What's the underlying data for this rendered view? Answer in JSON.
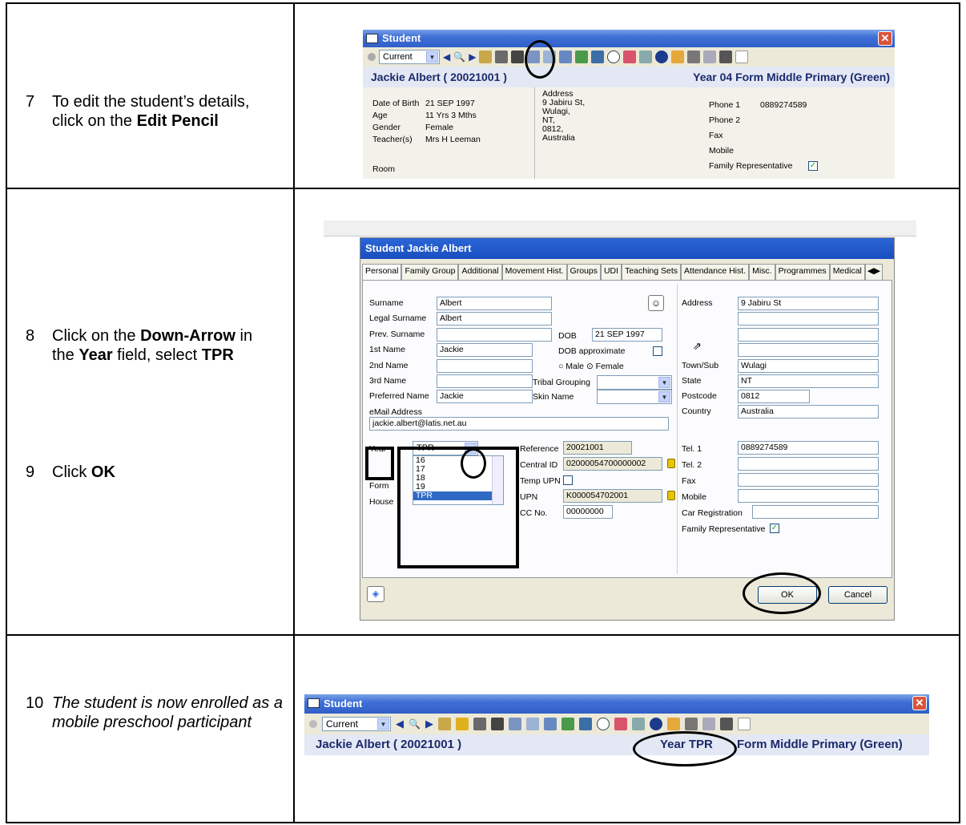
{
  "steps": [
    {
      "num": "7",
      "text_parts": [
        "To edit the student’s details, click on the ",
        "Edit Pencil"
      ]
    },
    {
      "num": "8",
      "text_parts": [
        "Click on the ",
        "Down-Arrow",
        " in the ",
        "Year",
        " field, select ",
        "TPR"
      ]
    },
    {
      "num": "9",
      "text_parts": [
        "Click ",
        "OK"
      ]
    },
    {
      "num": "10",
      "text": "The student is now enrolled as a mobile preschool participant"
    }
  ],
  "window1": {
    "title": "Student",
    "filter_value": "Current",
    "student_header": "Jackie Albert  ( 20021001 )",
    "year_form": "Year 04   Form Middle Primary (Green)",
    "details": {
      "dob_label": "Date of Birth",
      "dob": "21 SEP 1997",
      "age_label": "Age",
      "age": "11 Yrs 3 Mths",
      "gender_label": "Gender",
      "gender": "Female",
      "teacher_label": "Teacher(s)",
      "teacher": "Mrs H Leeman",
      "room_label": "Room",
      "address_label": "Address",
      "address_lines": [
        "9 Jabiru St,",
        "Wulagi,",
        "NT,",
        "0812,",
        "Australia"
      ],
      "phone1_label": "Phone 1",
      "phone1": "0889274589",
      "phone2_label": "Phone 2",
      "fax_label": "Fax",
      "mobile_label": "Mobile",
      "family_rep_label": "Family Representative"
    }
  },
  "dialog": {
    "title": "Student Jackie Albert",
    "tabs": [
      "Personal",
      "Family Group",
      "Additional",
      "Movement Hist.",
      "Groups",
      "UDI",
      "Teaching Sets",
      "Attendance Hist.",
      "Misc.",
      "Programmes",
      "Medical"
    ],
    "labels": {
      "surname": "Surname",
      "legal_surname": "Legal Surname",
      "prev_surname": "Prev. Surname",
      "first_name": "1st Name",
      "second_name": "2nd Name",
      "third_name": "3rd Name",
      "preferred_name": "Preferred Name",
      "email": "eMail Address",
      "year": "Year",
      "form": "Form",
      "house": "House",
      "dob": "DOB",
      "dob_approx": "DOB approximate",
      "male": "Male",
      "female": "Female",
      "tribal": "Tribal Grouping",
      "skin": "Skin Name",
      "reference": "Reference",
      "central_id": "Central ID",
      "temp_upn": "Temp UPN",
      "upn": "UPN",
      "cc_no": "CC No.",
      "address": "Address",
      "town": "Town/Sub",
      "state": "State",
      "postcode": "Postcode",
      "country": "Country",
      "tel1": "Tel. 1",
      "tel2": "Tel. 2",
      "fax": "Fax",
      "mobile": "Mobile",
      "car_reg": "Car Registration",
      "family_rep": "Family Representative"
    },
    "values": {
      "surname": "Albert",
      "legal_surname": "Albert",
      "first_name": "Jackie",
      "preferred_name": "Jackie",
      "email": "jackie.albert@latis.net.au",
      "dob": "21 SEP 1997",
      "year": "TPR",
      "reference": "20021001",
      "central_id": "02000054700000002",
      "upn": "K000054702001",
      "cc_no": "00000000",
      "address1": "9 Jabiru St",
      "town": "Wulagi",
      "state": "NT",
      "postcode": "0812",
      "country": "Australia",
      "tel1": "0889274589"
    },
    "year_options": [
      "16",
      "17",
      "18",
      "19",
      "TPR"
    ],
    "ok_label": "OK",
    "cancel_label": "Cancel"
  },
  "window3": {
    "title": "Student",
    "filter_value": "Current",
    "student_header": "Jackie Albert  ( 20021001 )",
    "year_text": "Year TPR",
    "form_text": "Form Middle Primary (Green)"
  }
}
